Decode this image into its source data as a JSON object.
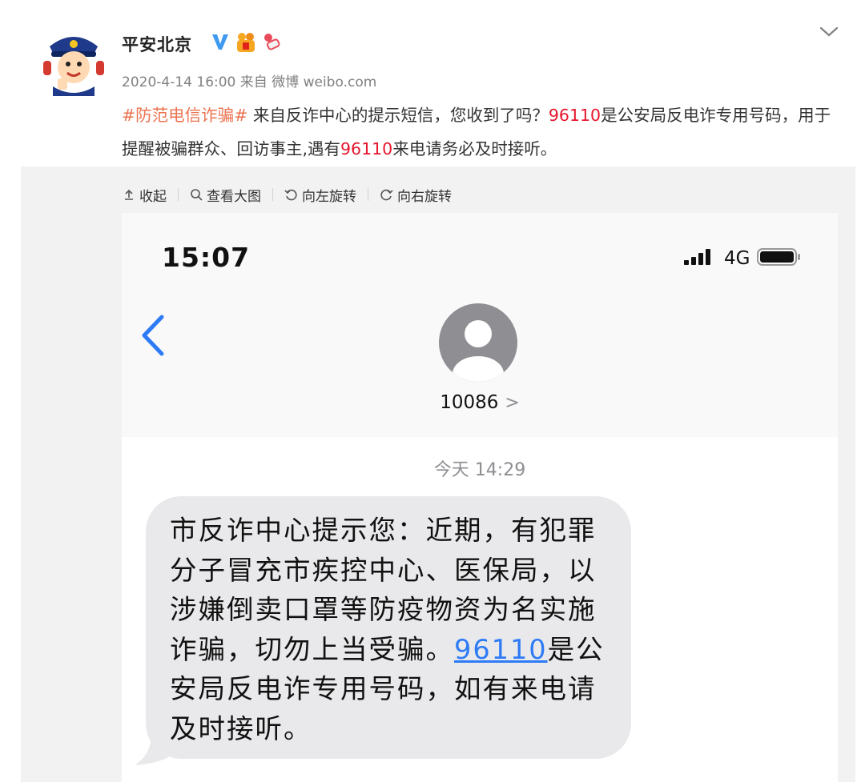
{
  "post": {
    "author": "平安北京",
    "meta": "2020-4-14 16:00 来自 微博 weibo.com",
    "text_topic": "#防范电信诈骗#",
    "text_part1": " 来自反诈中心的提示短信，您收到了吗？",
    "text_number1": "96110",
    "text_part2": "是公安局反电诈专用号码，用于提醒被骗群众、回访事主,遇有",
    "text_number2": "96110",
    "text_part3": "来电请务必及时接听。",
    "accent_color": "#eb7350",
    "number_color": "#e6162d",
    "icons": [
      "verified-v-icon",
      "badge-icon",
      "badge-icon-2",
      "chevron-down-icon"
    ]
  },
  "viewer_toolbar": {
    "collapse": "收起",
    "view_large": "查看大图",
    "rotate_left": "向左旋转",
    "rotate_right": "向右旋转"
  },
  "phone": {
    "time": "15:07",
    "network": "4G",
    "contact": "10086",
    "contact_arrow": ">",
    "day_label": "今天 14:29",
    "message_before": "市反诈中心提示您：近期，有犯罪分子冒充市疾控中心、医保局，以涉嫌倒卖口罩等防疫物资为名实施诈骗，切勿上当受骗。",
    "message_link": "96110",
    "message_after": "是公安局反电诈专用号码，如有来电请及时接听。",
    "bubble_color": "#e9e9eb",
    "link_color": "#2e7bf6"
  }
}
